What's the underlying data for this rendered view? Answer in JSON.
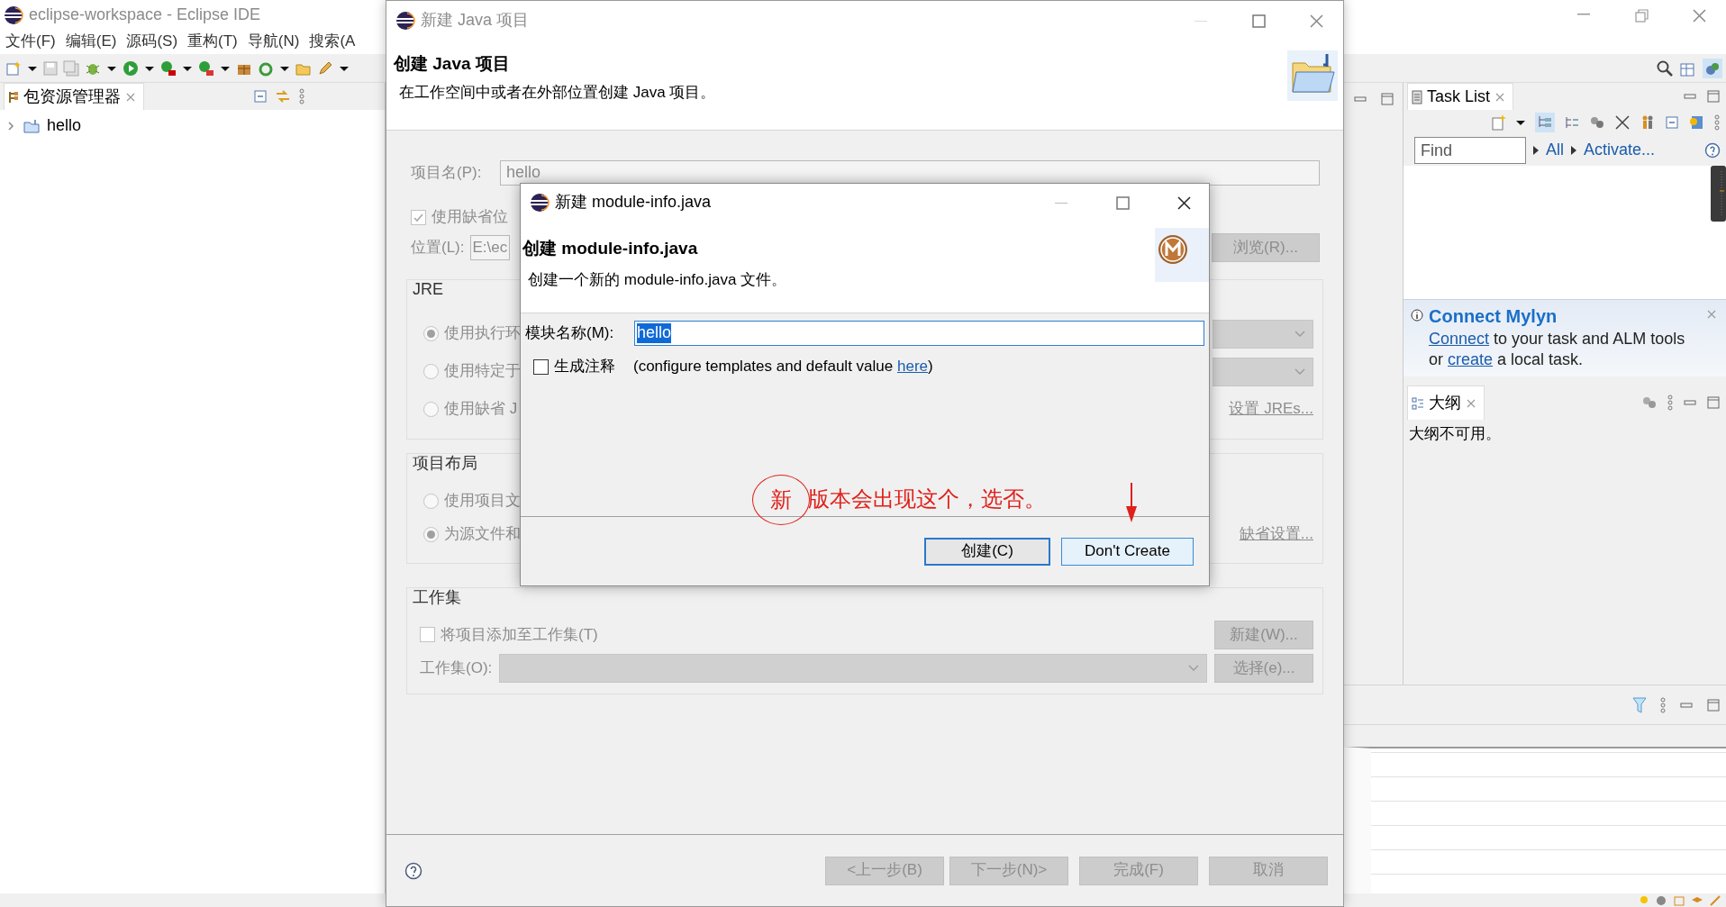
{
  "ide": {
    "title": "eclipse-workspace - Eclipse IDE",
    "menu": [
      "文件(F)",
      "编辑(E)",
      "源码(S)",
      "重构(T)",
      "导航(N)",
      "搜索(A"
    ],
    "package_explorer": {
      "tab": "包资源管理器",
      "tree": [
        {
          "label": "hello",
          "expanded": false
        }
      ]
    },
    "task_list": {
      "tab": "Task List",
      "find": {
        "placeholder": "Find"
      },
      "filters": [
        "All",
        "Activate..."
      ]
    },
    "mylyn": {
      "title": "Connect Mylyn",
      "message": [
        {
          "kind": "link",
          "text": "Connect"
        },
        {
          "kind": "text",
          "text": " to your task and ALM tools or "
        },
        {
          "kind": "link",
          "text": "create"
        },
        {
          "kind": "text",
          "text": " a local task."
        }
      ]
    },
    "outline": {
      "tab": "大纲",
      "message": "大纲不可用。"
    }
  },
  "java_dialog": {
    "title": "新建 Java 项目",
    "heading": "创建 Java 项目",
    "description": "在工作空间中或者在外部位置创建 Java 项目。",
    "project_name": {
      "label": "项目名(P):",
      "value": "hello"
    },
    "use_default_location": {
      "label": "使用缺省位",
      "checked": true
    },
    "location": {
      "label": "位置(L):",
      "value": "E:\\ec"
    },
    "browse_button": "浏览(R)...",
    "jre": {
      "title": "JRE",
      "options": [
        {
          "label": "使用执行环",
          "selected": true
        },
        {
          "label": "使用特定于",
          "selected": false
        },
        {
          "label": "使用缺省 J",
          "selected": false
        }
      ],
      "link": "设置 JREs..."
    },
    "project_layout": {
      "title": "项目布局",
      "options": [
        {
          "label": "使用项目文",
          "selected": false
        },
        {
          "label": "为源文件和",
          "selected": true
        }
      ],
      "link": "缺省设置..."
    },
    "working_sets": {
      "title": "工作集",
      "add": {
        "label": "将项目添加至工作集(T)",
        "checked": false
      },
      "new_button": "新建(W)...",
      "sets_label": "工作集(O):",
      "select_button": "选择(e)..."
    },
    "buttons": [
      "<上一步(B)",
      "下一步(N)>",
      "完成(F)",
      "取消"
    ]
  },
  "module_dialog": {
    "title": "新建 module-info.java",
    "heading": "创建 module-info.java",
    "description": "创建一个新的 module-info.java 文件。",
    "module_name": {
      "label": "模块名称(M):",
      "value": "hello",
      "text_selected": true
    },
    "generate_comments": {
      "label": "生成注释",
      "checked": false
    },
    "hint": [
      {
        "kind": "text",
        "text": "(configure templates and default value "
      },
      {
        "kind": "link",
        "text": "here"
      },
      {
        "kind": "text",
        "text": ")"
      }
    ],
    "buttons": [
      {
        "label": "创建(C)",
        "default": true
      },
      {
        "label": "Don't Create",
        "default": false
      }
    ]
  },
  "annotation": {
    "circled": "新",
    "text": "版本会出现这个，选否。"
  }
}
